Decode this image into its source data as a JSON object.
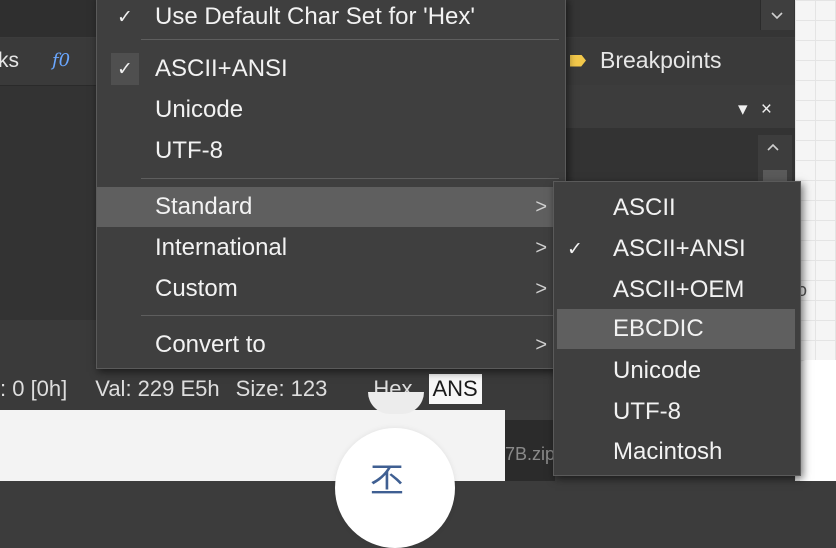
{
  "background": {
    "tab_left_text": "ks",
    "fx_icon": "f0",
    "breakpoints_tab": "Breakpoints",
    "pane_controls": "▾ ×",
    "status": {
      "position": ": 0 [0h]",
      "value": "Val: 229 E5h",
      "size": "Size: 123",
      "mode": "Hex",
      "charset": "ANS"
    },
    "zip_text": "7B.zip",
    "circle_glyph": "丕",
    "right_glyph": "o"
  },
  "main_menu": {
    "items": [
      {
        "label": "Use Default Char Set for 'Hex'",
        "checked": true
      },
      {
        "label": "ASCII+ANSI",
        "checked": true
      },
      {
        "label": "Unicode",
        "checked": false
      },
      {
        "label": "UTF-8",
        "checked": false
      },
      {
        "label": "Standard",
        "submenu": true,
        "highlighted": true
      },
      {
        "label": "International",
        "submenu": true
      },
      {
        "label": "Custom",
        "submenu": true
      },
      {
        "label": "Convert to",
        "submenu": true
      }
    ],
    "check_glyph": "✓",
    "arrow_glyph": ">"
  },
  "sub_menu": {
    "items": [
      {
        "label": "ASCII",
        "checked": false
      },
      {
        "label": "ASCII+ANSI",
        "checked": true
      },
      {
        "label": "ASCII+OEM",
        "checked": false
      },
      {
        "label": "EBCDIC",
        "checked": false,
        "highlighted": true
      },
      {
        "label": "Unicode",
        "checked": false
      },
      {
        "label": "UTF-8",
        "checked": false
      },
      {
        "label": "Macintosh",
        "checked": false
      }
    ]
  },
  "colors": {
    "menu_bg": "#3f3f3f",
    "highlight": "#5f5f5f",
    "accent_icon": "#f2c84b",
    "fx_blue": "#6aa7ff"
  }
}
